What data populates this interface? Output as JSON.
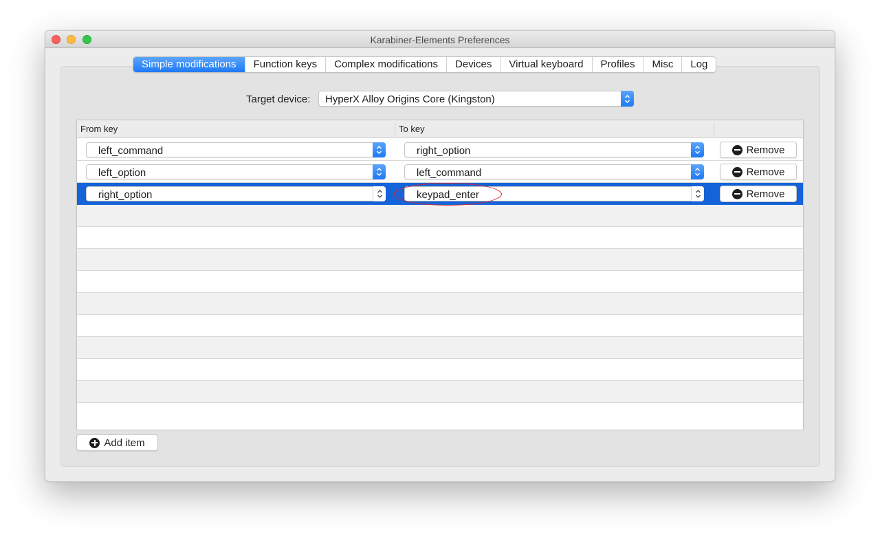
{
  "window": {
    "title": "Karabiner-Elements Preferences"
  },
  "tabs": [
    {
      "label": "Simple modifications",
      "active": true
    },
    {
      "label": "Function keys"
    },
    {
      "label": "Complex modifications"
    },
    {
      "label": "Devices"
    },
    {
      "label": "Virtual keyboard"
    },
    {
      "label": "Profiles"
    },
    {
      "label": "Misc"
    },
    {
      "label": "Log"
    }
  ],
  "target": {
    "label": "Target device:",
    "value": "HyperX Alloy Origins Core (Kingston)"
  },
  "table": {
    "headers": {
      "from": "From key",
      "to": "To key"
    },
    "rows": [
      {
        "from": "left_command",
        "to": "right_option",
        "remove": "Remove"
      },
      {
        "from": "left_option",
        "to": "left_command",
        "remove": "Remove"
      },
      {
        "from": "right_option",
        "to": "keypad_enter",
        "remove": "Remove",
        "selected": true
      }
    ]
  },
  "add_item": "Add item",
  "colors": {
    "accent": "#1e79f4",
    "selection": "#1463d8",
    "annotation": "#d8232a"
  }
}
